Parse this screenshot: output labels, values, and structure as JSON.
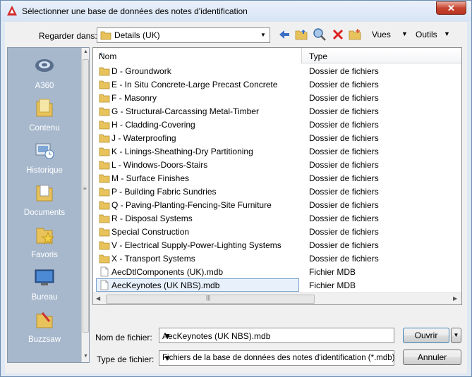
{
  "window": {
    "title": "Sélectionner une base de données des notes d'identification",
    "close_label": "✕"
  },
  "toolbar": {
    "look_in_label": "Regarder dans:",
    "look_in_value": "Details (UK)",
    "views_label": "Vues",
    "tools_label": "Outils"
  },
  "places": [
    {
      "label": "A360",
      "icon": "a360-icon"
    },
    {
      "label": "Contenu",
      "icon": "content-folder-icon"
    },
    {
      "label": "Historique",
      "icon": "history-icon"
    },
    {
      "label": "Documents",
      "icon": "documents-icon"
    },
    {
      "label": "Favoris",
      "icon": "favorites-icon"
    },
    {
      "label": "Bureau",
      "icon": "desktop-icon"
    },
    {
      "label": "Buzzsaw",
      "icon": "buzzsaw-icon"
    }
  ],
  "list": {
    "columns": [
      "Nom",
      "Type"
    ],
    "rows": [
      {
        "name": "D - Groundwork",
        "type": "Dossier de fichiers",
        "kind": "folder"
      },
      {
        "name": "E - In Situ Concrete-Large Precast Concrete",
        "type": "Dossier de fichiers",
        "kind": "folder"
      },
      {
        "name": "F - Masonry",
        "type": "Dossier de fichiers",
        "kind": "folder"
      },
      {
        "name": "G - Structural-Carcassing Metal-Timber",
        "type": "Dossier de fichiers",
        "kind": "folder"
      },
      {
        "name": "H - Cladding-Covering",
        "type": "Dossier de fichiers",
        "kind": "folder"
      },
      {
        "name": "J - Waterproofing",
        "type": "Dossier de fichiers",
        "kind": "folder"
      },
      {
        "name": "K - Linings-Sheathing-Dry Partitioning",
        "type": "Dossier de fichiers",
        "kind": "folder"
      },
      {
        "name": "L - Windows-Doors-Stairs",
        "type": "Dossier de fichiers",
        "kind": "folder"
      },
      {
        "name": "M - Surface Finishes",
        "type": "Dossier de fichiers",
        "kind": "folder"
      },
      {
        "name": "P - Building Fabric Sundries",
        "type": "Dossier de fichiers",
        "kind": "folder"
      },
      {
        "name": "Q - Paving-Planting-Fencing-Site Furniture",
        "type": "Dossier de fichiers",
        "kind": "folder"
      },
      {
        "name": "R - Disposal Systems",
        "type": "Dossier de fichiers",
        "kind": "folder"
      },
      {
        "name": "Special Construction",
        "type": "Dossier de fichiers",
        "kind": "folder"
      },
      {
        "name": "V - Electrical Supply-Power-Lighting Systems",
        "type": "Dossier de fichiers",
        "kind": "folder"
      },
      {
        "name": "X - Transport Systems",
        "type": "Dossier de fichiers",
        "kind": "folder"
      },
      {
        "name": "AecDtlComponents (UK).mdb",
        "type": "Fichier MDB",
        "kind": "file"
      },
      {
        "name": "AecKeynotes (UK NBS).mdb",
        "type": "Fichier MDB",
        "kind": "file",
        "selected": true
      }
    ]
  },
  "bottom": {
    "file_name_label": "Nom de fichier:",
    "file_name_value": "AecKeynotes (UK NBS).mdb",
    "file_type_label": "Type de fichier:",
    "file_type_value": "Fichiers de la base de données des notes d'identification (*.mdb)",
    "open_label": "Ouvrir",
    "cancel_label": "Annuler"
  }
}
